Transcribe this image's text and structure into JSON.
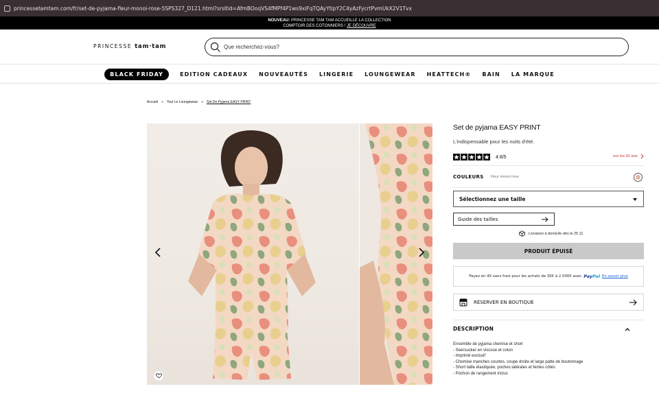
{
  "browser": {
    "url": "princessetamtam.com/fr/set-de-pyjama-fleur-monoi-rose-5SPS327_D121.html?srsltid=AfmBOoqVS4fMPf4P1ws9xiFqTQAyYtipY2C4yAzFycrtPvmUkX2V1Tvx"
  },
  "announcement": {
    "line1_bold": "NOUVEAU:",
    "line1_rest": " PRINCESSE TAM TAM ACCUEILLE LA COLLECTION",
    "line2": "COMPTOIR DES COTONNIERS ! ",
    "link": "JE DÉCOUVRE"
  },
  "header": {
    "logo_word": "PRINCESSE ",
    "logo_brand": "tam·tam",
    "search_placeholder": "Que recherchez-vous?"
  },
  "nav": {
    "items": [
      {
        "label": "BLACK FRIDAY"
      },
      {
        "label": "EDITION CADEAUX"
      },
      {
        "label": "NOUVEAUTÉS"
      },
      {
        "label": "LINGERIE"
      },
      {
        "label": "LOUNGEWEAR"
      },
      {
        "label": "HEATTECH®"
      },
      {
        "label": "BAIN"
      },
      {
        "label": "LA MARQUE"
      }
    ]
  },
  "breadcrumb": {
    "items": [
      "Accueil",
      "Tout Le Loungewear",
      "Set De Pyjama EASY PRINT"
    ],
    "separator": "»"
  },
  "product": {
    "title": "Set de pyjama EASY PRINT",
    "subtitle": "L'indispensable pour les nuits d'été.",
    "rating": 4.8,
    "rating_text": "4.8/5",
    "stars": 5,
    "reviews_link": "voir les 50 avis",
    "colors_label": "COULEURS",
    "color_name": "Fleur monoi rose",
    "swatch_color": "#e8b4a0",
    "size_select": "Sélectionnez une taille",
    "size_guide": "Guide des tailles",
    "delivery": "Livraison à domicile dès le 25.11",
    "sold_out": "PRODUIT ÉPUISÉ",
    "paypal_text": "Payez en 4X sans frais pour les achats de 30€ à 2 000€ avec",
    "paypal_brand_a": "Pay",
    "paypal_brand_b": "Pal",
    "paypal_more": "En savoir plus",
    "store_label": "RÉSERVER EN BOUTIQUE",
    "description_label": "DESCRIPTION",
    "description_lines": [
      "Ensemble de pyjama chemise et short",
      "- Seersucker en viscose et coton",
      "- Imprimé exclusif",
      "- Chemise manches courtes, coupe droite et large patte de boutonnage",
      "- Short taille élastiquée, poches latérales et fentes côtés",
      "- Pochon de rangement inclus"
    ]
  },
  "colors": {
    "accent": "#000000",
    "review_link": "#c03b3b",
    "soldout_bg": "#c9c9c9",
    "paypal_dark": "#1b3a8c",
    "paypal_light": "#179bd7"
  }
}
